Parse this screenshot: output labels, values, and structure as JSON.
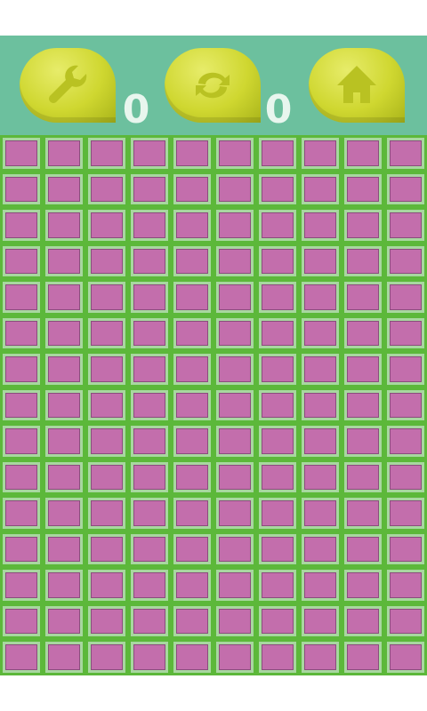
{
  "toolbar": {
    "buttons": [
      {
        "id": "tools",
        "icon": "wrench-icon"
      },
      {
        "id": "restart",
        "icon": "refresh-icon"
      },
      {
        "id": "home",
        "icon": "home-icon"
      }
    ],
    "counters": [
      "0",
      "0"
    ],
    "colors": {
      "bar": "#6cc09e",
      "button": "#cfd730"
    }
  },
  "board": {
    "rows": 15,
    "columns": 10,
    "tile_color": "#c36eac",
    "grid_color": "#5cb83a"
  }
}
